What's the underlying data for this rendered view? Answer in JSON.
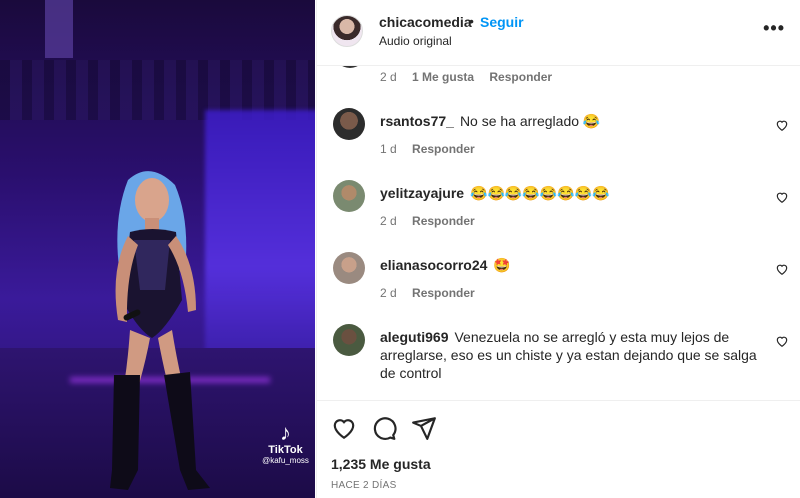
{
  "media": {
    "watermark": {
      "logo": "♪",
      "brand": "TikTok",
      "handle": "@kafu_moss"
    }
  },
  "header": {
    "username": "chicacomedia",
    "separator": "•",
    "follow_label": "Seguir",
    "subtitle": "Audio original",
    "more_label": "•••"
  },
  "partial_comment": {
    "age": "2 d",
    "likes": "1 Me gusta",
    "reply": "Responder"
  },
  "comments": [
    {
      "user": "rsantos77_",
      "text": "No se ha arreglado 😂",
      "age": "1 d",
      "reply": "Responder"
    },
    {
      "user": "yelitzayajure",
      "text": "😂😂😂😂😂😂😂😂",
      "age": "2 d",
      "reply": "Responder"
    },
    {
      "user": "elianasocorro24",
      "text": "🤩",
      "age": "2 d",
      "reply": "Responder"
    },
    {
      "user": "aleguti969",
      "text": "Venezuela no se arregló y esta muy lejos de arreglarse, eso es un chiste y ya estan dejando que se salga de control",
      "age": "",
      "reply": ""
    }
  ],
  "footer": {
    "likes": "1,235 Me gusta",
    "date": "HACE 2 DÍAS",
    "icons": [
      "heart-icon",
      "comment-icon",
      "share-icon"
    ]
  }
}
